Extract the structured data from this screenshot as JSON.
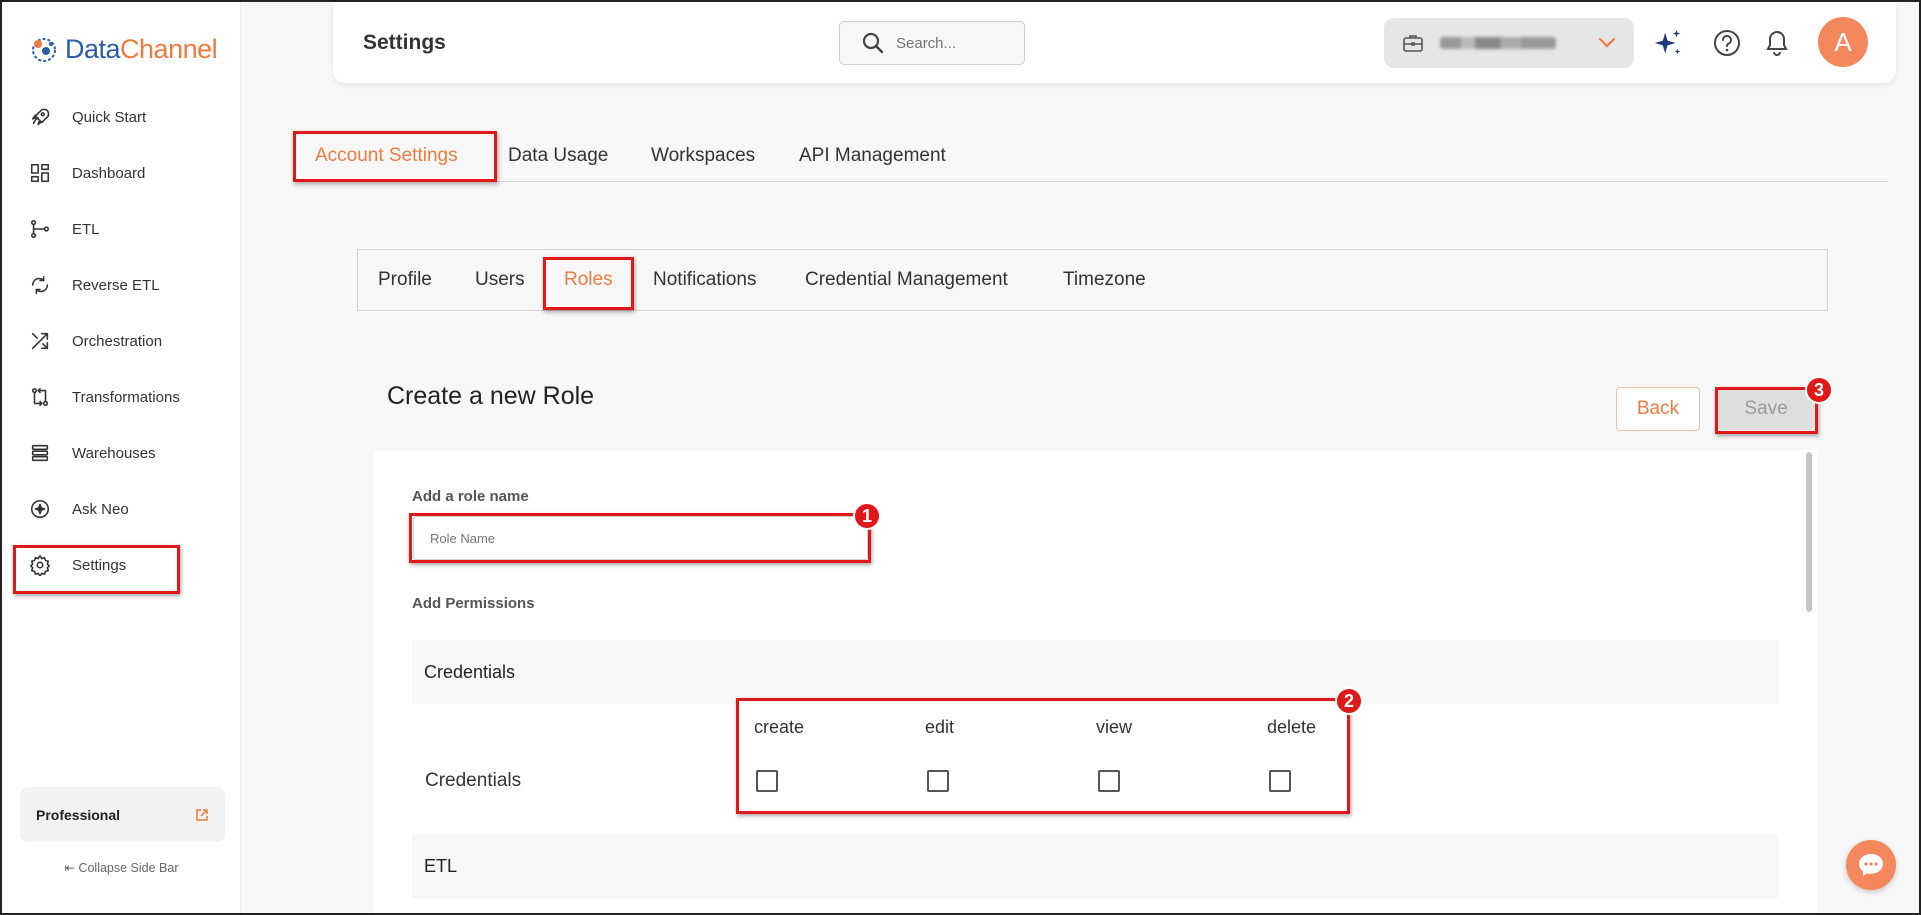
{
  "brand": {
    "part1": "Data",
    "part2": "Channel"
  },
  "sidebar": {
    "items": [
      {
        "label": "Quick Start",
        "icon": "rocket-icon"
      },
      {
        "label": "Dashboard",
        "icon": "grid-icon"
      },
      {
        "label": "ETL",
        "icon": "etl-icon"
      },
      {
        "label": "Reverse ETL",
        "icon": "reverse-etl-icon"
      },
      {
        "label": "Orchestration",
        "icon": "orchestration-icon"
      },
      {
        "label": "Transformations",
        "icon": "transform-icon"
      },
      {
        "label": "Warehouses",
        "icon": "stack-icon"
      },
      {
        "label": "Ask Neo",
        "icon": "sparkle-icon"
      },
      {
        "label": "Settings",
        "icon": "gear-icon"
      }
    ],
    "plan": "Professional",
    "collapse": "Collapse Side Bar"
  },
  "topbar": {
    "title": "Settings",
    "search_placeholder": "Search...",
    "avatar_letter": "A"
  },
  "main_tabs": [
    "Account Settings",
    "Data Usage",
    "Workspaces",
    "API Management"
  ],
  "sub_tabs": [
    "Profile",
    "Users",
    "Roles",
    "Notifications",
    "Credential Management",
    "Timezone"
  ],
  "page": {
    "heading": "Create a new Role",
    "back": "Back",
    "save": "Save",
    "role_label": "Add a role name",
    "role_placeholder": "Role Name",
    "permissions_label": "Add Permissions"
  },
  "groups": [
    {
      "title": "Credentials",
      "row": "Credentials",
      "permissions": [
        "create",
        "edit",
        "view",
        "delete"
      ]
    },
    {
      "title": "ETL"
    }
  ],
  "annotations": [
    "1",
    "2",
    "3"
  ],
  "colors": {
    "accent": "#ef7b3f",
    "highlight": "#e01818",
    "brand_blue": "#2c5da8"
  }
}
